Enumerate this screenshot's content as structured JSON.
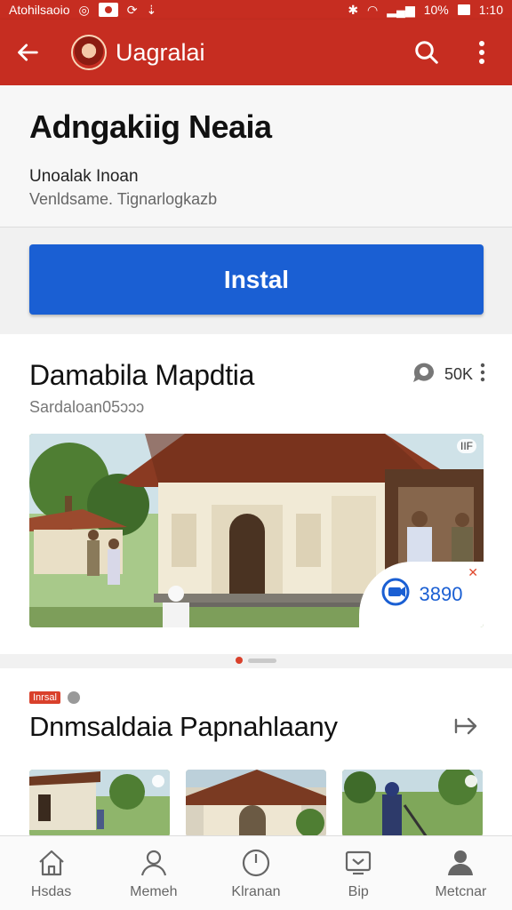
{
  "status_bar": {
    "left_text": "Atohilsaoio",
    "right_text": "10%",
    "time": "1:10"
  },
  "app_bar": {
    "title": "Uagralai"
  },
  "header": {
    "title": "Adngakiig Neaia",
    "developer": "Unoalak Inoan",
    "subtitle": "Venldsame. Tignarlogkazb"
  },
  "install": {
    "label": "Instal"
  },
  "featured": {
    "title": "Damabila Mapdtia",
    "subtitle": "Sardaloan05ɔɔɔ",
    "meta_count": "50K",
    "image_badge": "IIF",
    "pill_value": "3890"
  },
  "section": {
    "tag": "Inrsal",
    "title": "Dnmsaldaia Papnahlaany"
  },
  "bottom_nav": {
    "items": [
      {
        "label": "Hsdas",
        "icon": "home-icon"
      },
      {
        "label": "Memeh",
        "icon": "person-icon"
      },
      {
        "label": "Klranan",
        "icon": "clock-icon"
      },
      {
        "label": "Bip",
        "icon": "inbox-icon"
      },
      {
        "label": "Metcnar",
        "icon": "account-icon"
      }
    ]
  },
  "colors": {
    "brand_red": "#c62d21",
    "install_blue": "#1a5fd3"
  }
}
